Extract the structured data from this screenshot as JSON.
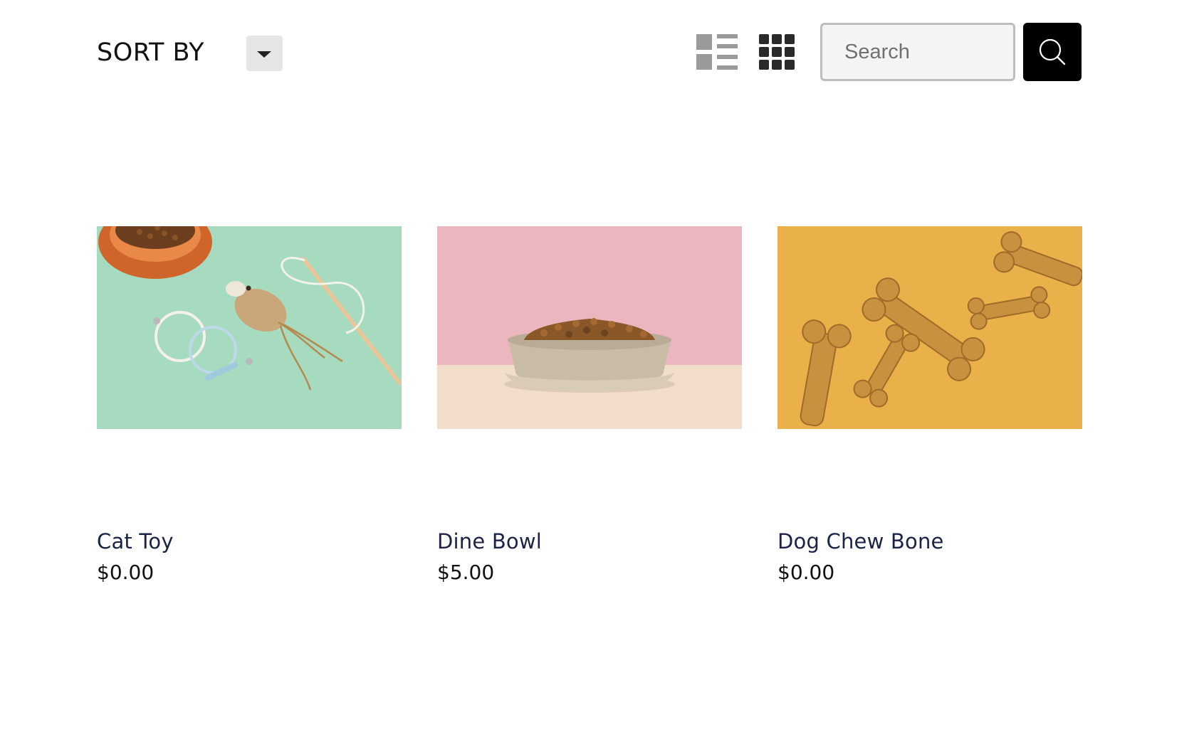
{
  "toolbar": {
    "sort_label": "SORT BY",
    "sort_dropdown_icon": "caret-down-icon",
    "list_view_icon": "list-view-icon",
    "grid_view_icon": "grid-view-icon",
    "search_placeholder": "Search",
    "search_value": "",
    "search_icon": "search-icon"
  },
  "colors": {
    "product_name": "#1d2346",
    "search_button_bg": "#000000",
    "dropdown_bg": "#e6e6e6",
    "list_icon": "#9a9a9a",
    "grid_icon": "#2a2a2a"
  },
  "products": [
    {
      "name": "Cat Toy",
      "price": "$0.00"
    },
    {
      "name": "Dine Bowl",
      "price": "$5.00"
    },
    {
      "name": "Dog Chew Bone",
      "price": "$0.00"
    }
  ]
}
